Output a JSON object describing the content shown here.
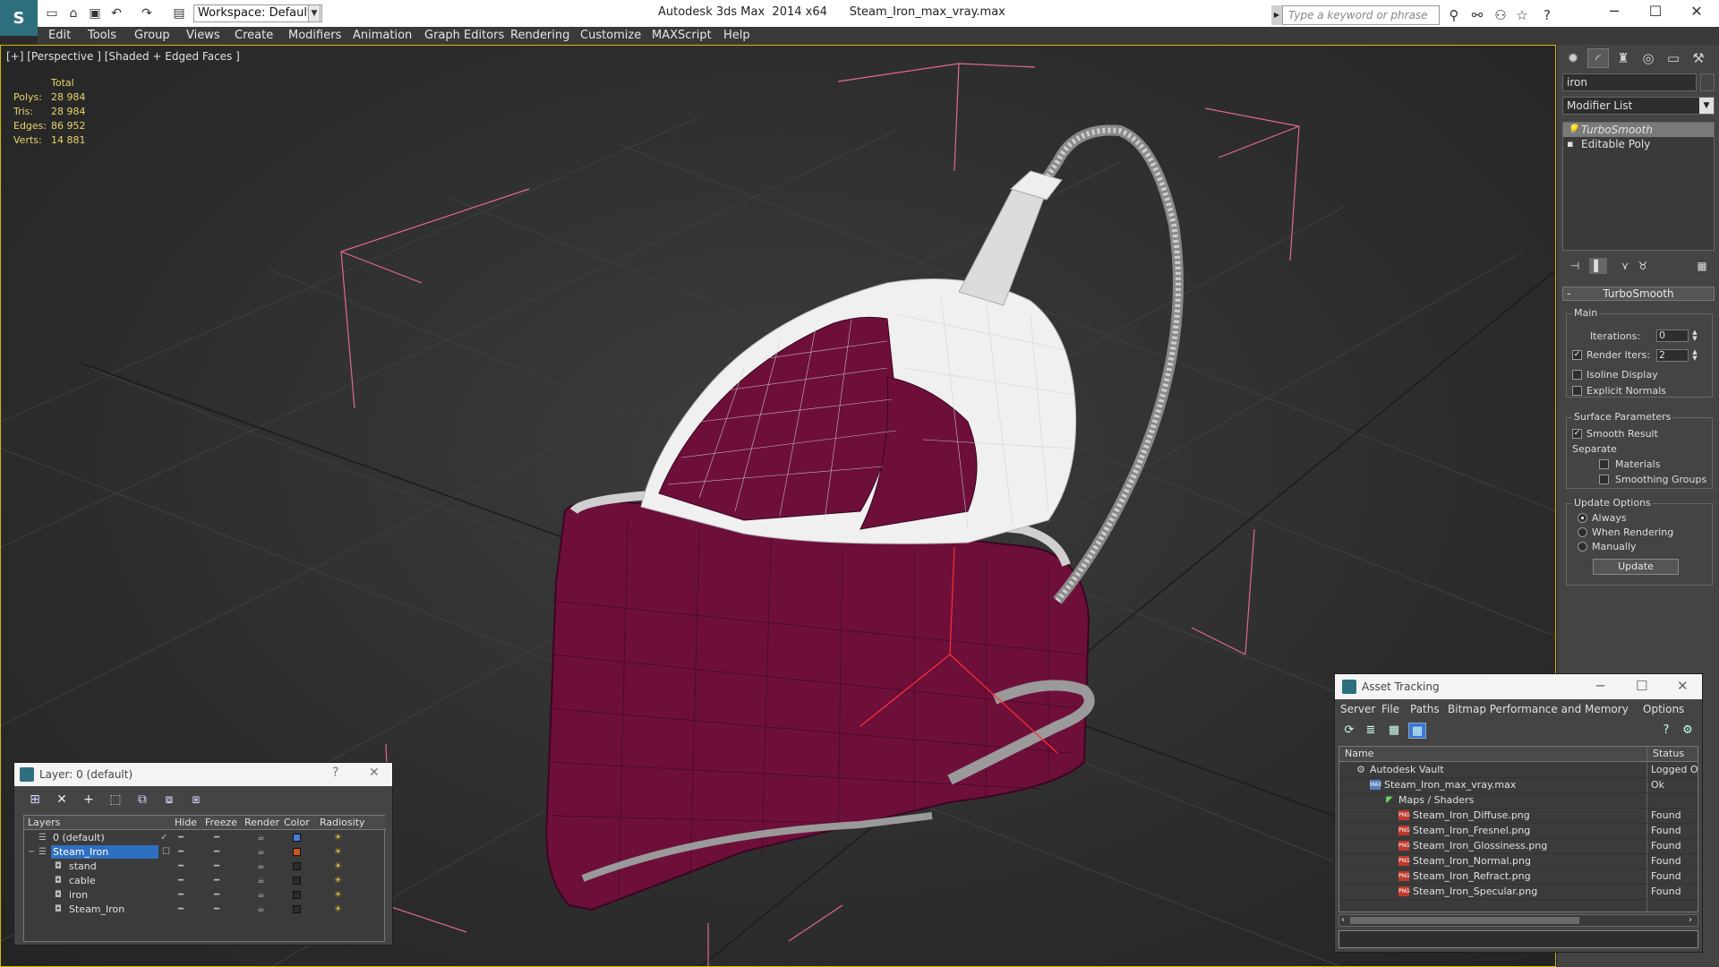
{
  "titlebar": {
    "app_title": "Autodesk 3ds Max  2014 x64",
    "file_name": "Steam_Iron_max_vray.max",
    "workspace": "Workspace: Default",
    "search_placeholder": "Type a keyword or phrase"
  },
  "menu": [
    "Edit",
    "Tools",
    "Group",
    "Views",
    "Create",
    "Modifiers",
    "Animation",
    "Graph Editors",
    "Rendering",
    "Customize",
    "MAXScript",
    "Help"
  ],
  "viewport": {
    "label": "[+] [Perspective ] [Shaded + Edged Faces ]",
    "stats_header": "Total",
    "stats": [
      {
        "k": "Polys:",
        "v": "28 984"
      },
      {
        "k": "Tris:",
        "v": "28 984"
      },
      {
        "k": "Edges:",
        "v": "86 952"
      },
      {
        "k": "Verts:",
        "v": "14 881"
      }
    ]
  },
  "command_panel": {
    "object_name": "iron",
    "modifier_list": "Modifier List",
    "stack": [
      "TurboSmooth",
      "Editable Poly"
    ],
    "rollout": "TurboSmooth",
    "main_group": "Main",
    "iterations_label": "Iterations:",
    "iterations_value": "0",
    "render_iters_label": "Render Iters:",
    "render_iters_value": "2",
    "isoline": "Isoline Display",
    "explicit_normals": "Explicit Normals",
    "surface_group": "Surface Parameters",
    "smooth_result": "Smooth Result",
    "separate": "Separate",
    "materials": "Materials",
    "smoothing_groups": "Smoothing Groups",
    "update_group": "Update Options",
    "always": "Always",
    "when_rendering": "When Rendering",
    "manually": "Manually",
    "update_button": "Update"
  },
  "layer_window": {
    "title": "Layer: 0 (default)",
    "columns": [
      "Layers",
      "Hide",
      "Freeze",
      "Render",
      "Color",
      "Radiosity"
    ],
    "rows": [
      {
        "name": "0 (default)",
        "color": "#4a7ad8"
      },
      {
        "name": "Steam_Iron",
        "color": "#c85a1e"
      },
      {
        "name": "stand",
        "color": "#2b2b2b"
      },
      {
        "name": "cable",
        "color": "#2b2b2b"
      },
      {
        "name": "iron",
        "color": "#2b2b2b"
      },
      {
        "name": "Steam_Iron",
        "color": "#2b2b2b"
      }
    ]
  },
  "asset_window": {
    "title": "Asset Tracking",
    "menu": [
      "Server",
      "File",
      "Paths",
      "Bitmap Performance and Memory",
      "Options"
    ],
    "columns": [
      "Name",
      "Status"
    ],
    "rows": [
      {
        "name": "Autodesk Vault",
        "status": "Logged O"
      },
      {
        "name": "Steam_Iron_max_vray.max",
        "status": "Ok"
      },
      {
        "name": "Maps / Shaders",
        "status": ""
      },
      {
        "name": "Steam_Iron_Diffuse.png",
        "status": "Found"
      },
      {
        "name": "Steam_Iron_Fresnel.png",
        "status": "Found"
      },
      {
        "name": "Steam_Iron_Glossiness.png",
        "status": "Found"
      },
      {
        "name": "Steam_Iron_Normal.png",
        "status": "Found"
      },
      {
        "name": "Steam_Iron_Refract.png",
        "status": "Found"
      },
      {
        "name": "Steam_Iron_Specular.png",
        "status": "Found"
      }
    ]
  },
  "colors": {
    "iron_body": "#6e0f3a",
    "iron_white": "#f0f0f0",
    "selection_box": "#e06a8a",
    "viewport_border": "#d6b800",
    "accent_blue": "#2f6fc0"
  }
}
